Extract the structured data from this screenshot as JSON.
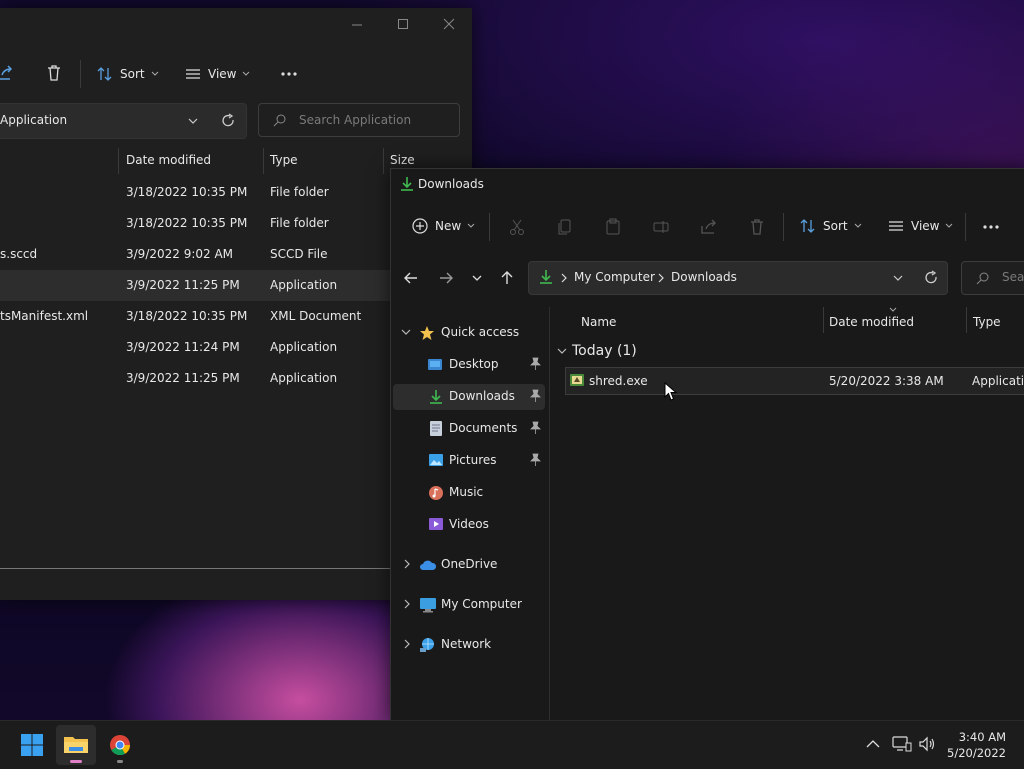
{
  "back_window": {
    "toolbar": {
      "sort_label": "Sort",
      "view_label": "View"
    },
    "address_text": "Application",
    "search_placeholder": "Search Application",
    "columns": [
      "Date modified",
      "Type",
      "Size"
    ],
    "rows": [
      {
        "name": "",
        "date": "3/18/2022 10:35 PM",
        "type": "File folder"
      },
      {
        "name": "",
        "date": "3/18/2022 10:35 PM",
        "type": "File folder"
      },
      {
        "name": "s.sccd",
        "date": "3/9/2022 9:02 AM",
        "type": "SCCD File"
      },
      {
        "name": "",
        "date": "3/9/2022 11:25 PM",
        "type": "Application"
      },
      {
        "name": "tsManifest.xml",
        "date": "3/18/2022 10:35 PM",
        "type": "XML Document"
      },
      {
        "name": "",
        "date": "3/9/2022 11:24 PM",
        "type": "Application"
      },
      {
        "name": "",
        "date": "3/9/2022 11:25 PM",
        "type": "Application"
      }
    ]
  },
  "front_window": {
    "title": "Downloads",
    "toolbar": {
      "new_label": "New",
      "sort_label": "Sort",
      "view_label": "View"
    },
    "breadcrumb": [
      "My Computer",
      "Downloads"
    ],
    "search_placeholder": "Searc",
    "nav": {
      "quick_access": "Quick access",
      "items": [
        {
          "label": "Desktop",
          "pinned": true
        },
        {
          "label": "Downloads",
          "pinned": true
        },
        {
          "label": "Documents",
          "pinned": true
        },
        {
          "label": "Pictures",
          "pinned": true
        },
        {
          "label": "Music",
          "pinned": false
        },
        {
          "label": "Videos",
          "pinned": false
        }
      ],
      "onedrive": "OneDrive",
      "my_computer": "My Computer",
      "network": "Network"
    },
    "columns": [
      "Name",
      "Date modified",
      "Type"
    ],
    "group_label": "Today (1)",
    "files": [
      {
        "name": "shred.exe",
        "date": "5/20/2022 3:38 AM",
        "type": "Applicatio"
      }
    ]
  },
  "taskbar": {
    "time": "3:40 AM",
    "date": "5/20/2022"
  },
  "colors": {
    "accent_green": "#3fb950",
    "folder_yellow": "#f2c14e",
    "start_blue": "#3aa0f0"
  }
}
